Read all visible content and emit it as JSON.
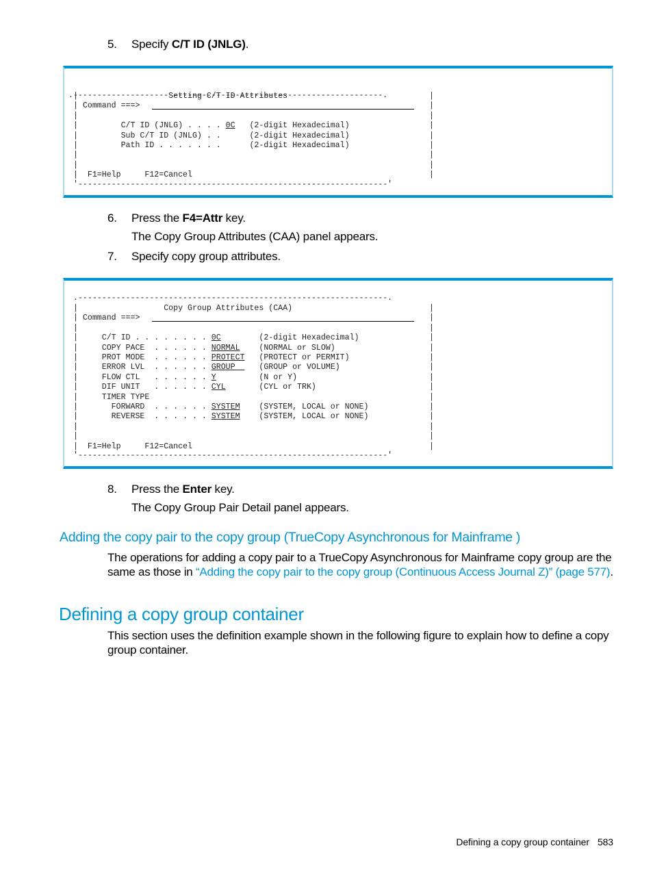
{
  "steps": {
    "s5": {
      "num": "5.",
      "pre": "Specify ",
      "bold": "C/T ID (JNLG)",
      "post": "."
    },
    "s6": {
      "num": "6.",
      "pre": "Press the ",
      "bold": "F4=Attr",
      "post": " key.",
      "note": "The Copy Group Attributes (CAA) panel appears."
    },
    "s7": {
      "num": "7.",
      "text": "Specify copy group attributes."
    },
    "s8": {
      "num": "8.",
      "pre": "Press the ",
      "bold": "Enter",
      "post": " key.",
      "note": "The Copy Group Pair Detail panel appears."
    }
  },
  "panel1": {
    "top_border": ".-----------------------------------------------------------------.",
    "title": "Setting C/T ID Attributes",
    "command_label": "Command ===>",
    "rows": [
      {
        "label": "C/T ID (JNLG) . . . .",
        "value": "0C",
        "hint": "(2-digit Hexadecimal)"
      },
      {
        "label": "Sub C/T ID (JNLG) . .",
        "value": "",
        "hint": "(2-digit Hexadecimal)"
      },
      {
        "label": "Path ID . . . . . . .",
        "value": "",
        "hint": "(2-digit Hexadecimal)"
      }
    ],
    "keys": "F1=Help     F12=Cancel",
    "bottom_border": "'-----------------------------------------------------------------'"
  },
  "panel2": {
    "top_border": ".-----------------------------------------------------------------.",
    "title": "Copy Group Attributes (CAA)",
    "command_label": "Command ===>",
    "rows": [
      {
        "label": "C/T ID . . . . . . . .",
        "value": "0C",
        "hint": "(2-digit Hexadecimal)"
      },
      {
        "label": "COPY PACE  . . . . . .",
        "value": "NORMAL",
        "hint": "(NORMAL or SLOW)"
      },
      {
        "label": "PROT MODE  . . . . . .",
        "value": "PROTECT",
        "hint": "(PROTECT or PERMIT)"
      },
      {
        "label": "ERROR LVL  . . . . . .",
        "value": "GROUP  ",
        "hint": "(GROUP or VOLUME)"
      },
      {
        "label": "FLOW CTL   . . . . . .",
        "value": "Y",
        "hint": "(N or Y)"
      },
      {
        "label": "DIF UNIT   . . . . . .",
        "value": "CYL",
        "hint": "(CYL or TRK)"
      },
      {
        "label": "TIMER TYPE",
        "value": "",
        "hint": ""
      },
      {
        "label": "  FORWARD  . . . . . .",
        "value": "SYSTEM",
        "hint": "(SYSTEM, LOCAL or NONE)"
      },
      {
        "label": "  REVERSE  . . . . . .",
        "value": "SYSTEM",
        "hint": "(SYSTEM, LOCAL or NONE)"
      }
    ],
    "keys": "F1=Help     F12=Cancel",
    "bottom_border": "'-----------------------------------------------------------------'"
  },
  "section_tca": {
    "heading": "Adding the copy pair to the copy group (TrueCopy Asynchronous for Mainframe )",
    "text_before": "The operations for adding a copy pair to a TrueCopy Asynchronous for Mainframe copy group are the same as those in ",
    "link": "“Adding the copy pair to the copy group (Continuous Access Journal Z)” (page 577)",
    "text_after": "."
  },
  "section_container": {
    "heading": "Defining a copy group container",
    "text": "This section uses the definition example shown in the following figure to explain how to define a copy group container."
  },
  "footer": {
    "title": "Defining a copy group container",
    "page": "583"
  }
}
